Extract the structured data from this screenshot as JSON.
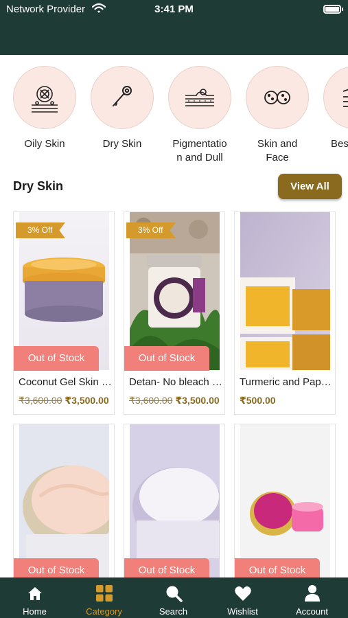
{
  "status_bar": {
    "carrier": "Network Provider",
    "time": "3:41 PM"
  },
  "categories": [
    {
      "label": "Oily Skin",
      "icon": "oily-skin-icon"
    },
    {
      "label": "Dry Skin",
      "icon": "dry-skin-icon"
    },
    {
      "label": "Pigmentation and Dull",
      "icon": "pigmentation-icon"
    },
    {
      "label": "Skin and Face",
      "icon": "skin-face-icon"
    },
    {
      "label": "Bes",
      "icon": "layers-icon"
    }
  ],
  "section": {
    "title": "Dry Skin",
    "view_all": "View All"
  },
  "products": [
    {
      "name": "Coconut Gel Skin Moisturizer",
      "badge": "3% Off",
      "status": "Out of Stock",
      "old_price": "₹3,600.00",
      "price": "₹3,500.00"
    },
    {
      "name": "Detan- No bleach cream",
      "badge": "3% Off",
      "status": "Out of Stock",
      "old_price": "₹3,600.00",
      "price": "₹3,500.00"
    },
    {
      "name": "Turmeric and Papaya Soap",
      "badge": "",
      "status": "",
      "old_price": "",
      "price": "₹500.00"
    },
    {
      "name": "",
      "badge": "",
      "status": "Out of Stock",
      "old_price": "",
      "price": ""
    },
    {
      "name": "",
      "badge": "",
      "status": "Out of Stock",
      "old_price": "",
      "price": ""
    },
    {
      "name": "",
      "badge": "",
      "status": "Out of Stock",
      "old_price": "",
      "price": ""
    }
  ],
  "tabs": [
    {
      "label": "Home",
      "icon": "home-icon"
    },
    {
      "label": "Category",
      "icon": "category-icon",
      "active": true
    },
    {
      "label": "Search",
      "icon": "search-icon"
    },
    {
      "label": "Wishlist",
      "icon": "heart-icon"
    },
    {
      "label": "Account",
      "icon": "account-icon"
    }
  ],
  "colors": {
    "header": "#1f3b36",
    "accent": "#8a6a1f",
    "badge": "#d49a2c",
    "out_of_stock": "#f08079",
    "category_bg": "#fbe8e2"
  }
}
